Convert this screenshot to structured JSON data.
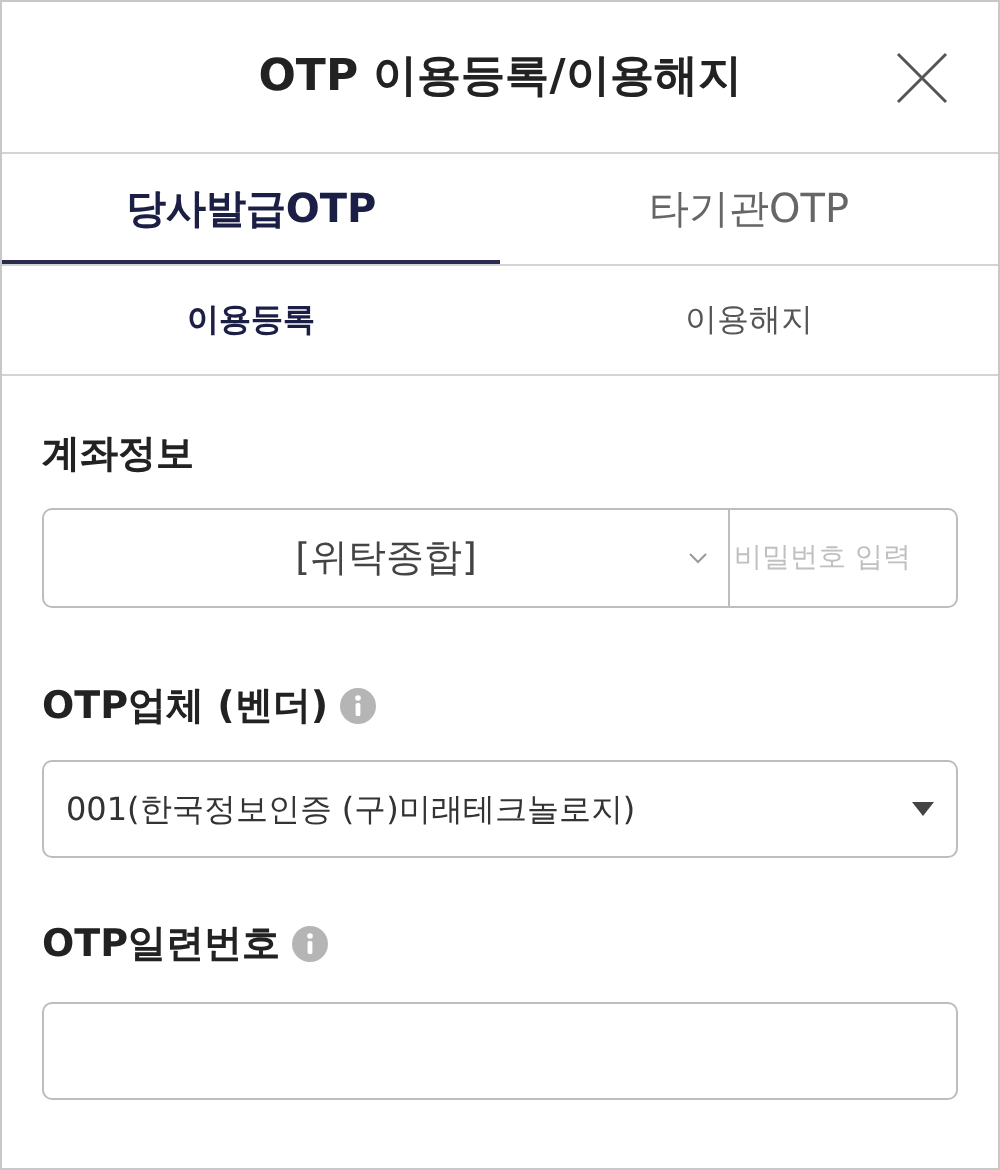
{
  "window": {
    "title": "OTP 이용등록/이용해지"
  },
  "tabs": [
    {
      "label": "당사발급OTP",
      "selected": true
    },
    {
      "label": "타기관OTP",
      "selected": false
    }
  ],
  "subtabs": [
    {
      "label": "이용등록",
      "selected": true
    },
    {
      "label": "이용해지",
      "selected": false
    }
  ],
  "account": {
    "label": "계좌정보",
    "value": "[위탁종합]",
    "password": {
      "placeholder": "비밀번호 입력"
    }
  },
  "vendor": {
    "label": "OTP업체 (벤더)",
    "value": "001(한국정보인증 (구)미래테크놀로지)"
  },
  "serial": {
    "label": "OTP일련번호"
  }
}
